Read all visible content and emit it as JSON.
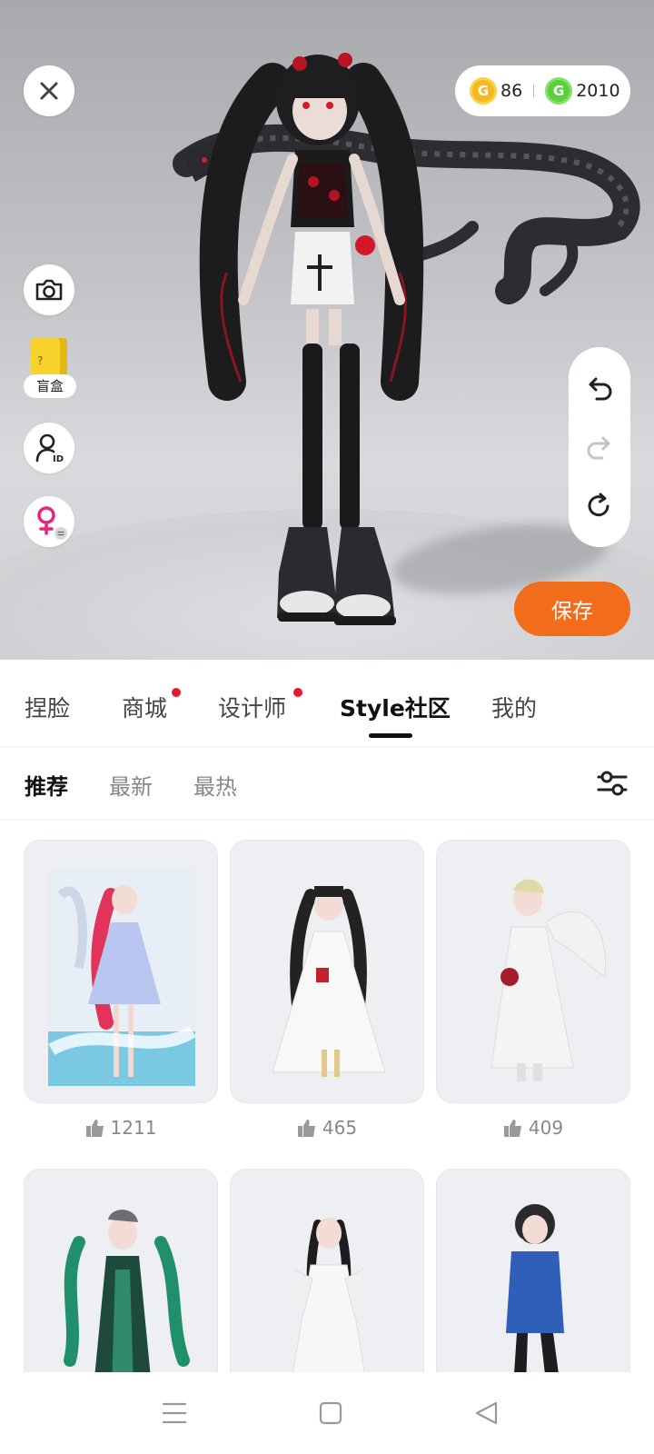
{
  "currency": {
    "gold_amount": "86",
    "green_amount": "2010",
    "gold_symbol": "G",
    "green_symbol": "G"
  },
  "side_tools": {
    "blind_box_label": "盲盒",
    "blind_box_mark": "?"
  },
  "save_label": "保存",
  "tabs": [
    {
      "label": "捏脸",
      "badge": false
    },
    {
      "label": "商城",
      "badge": true
    },
    {
      "label": "设计师",
      "badge": true
    },
    {
      "label": "Style社区",
      "badge": false,
      "active": true
    },
    {
      "label": "我的",
      "badge": false
    }
  ],
  "subtabs": [
    {
      "label": "推荐",
      "active": true
    },
    {
      "label": "最新"
    },
    {
      "label": "最热"
    }
  ],
  "feed": [
    {
      "likes": "1211",
      "theme": "teal-sea"
    },
    {
      "likes": "465",
      "theme": "white-gown"
    },
    {
      "likes": "409",
      "theme": "white-angel"
    },
    {
      "likes": "",
      "theme": "green-dress"
    },
    {
      "likes": "",
      "theme": "white-robe"
    },
    {
      "likes": "",
      "theme": "blue-hoodie"
    }
  ],
  "icons": {
    "close": "close-icon",
    "camera": "camera-icon",
    "avatar_id": "avatar-id-icon",
    "gender": "female-swap-icon",
    "undo": "undo-icon",
    "redo": "redo-icon",
    "reset": "reset-icon",
    "filter": "filter-sliders-icon",
    "thumbs_up": "thumbs-up-icon"
  },
  "colors": {
    "accent": "#f16d1b",
    "badge": "#e8192c",
    "gender_pink": "#e5257e"
  }
}
